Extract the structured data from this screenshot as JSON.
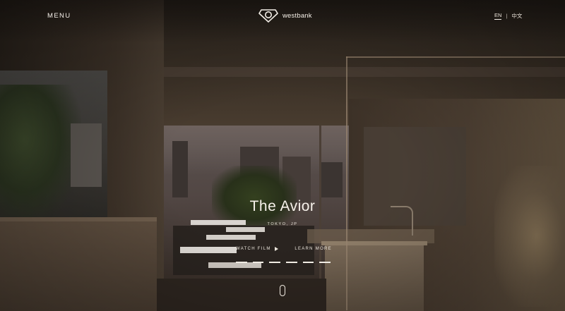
{
  "header": {
    "menu_label": "MENU",
    "logo_text": "westbank",
    "languages": [
      "EN",
      "中文"
    ],
    "active_language": "EN",
    "separator": "|"
  },
  "hero": {
    "title": "The Avior",
    "location": "TOKYO, JP",
    "watch_film_label": "WATCH FILM",
    "learn_more_label": "LEARN MORE",
    "slide_count": 6
  },
  "colors": {
    "text": "#f4efe8",
    "background": "#1c1814"
  }
}
